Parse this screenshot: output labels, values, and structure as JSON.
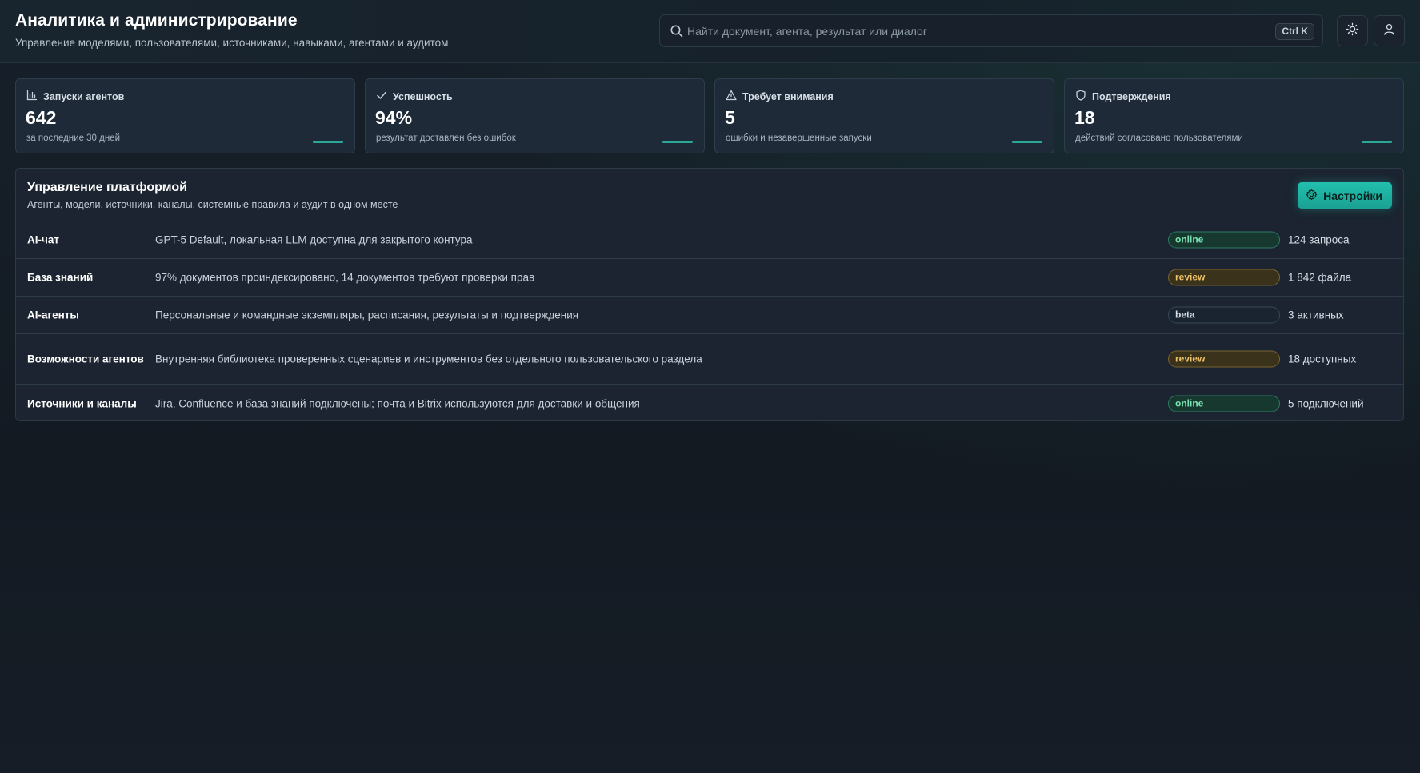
{
  "header": {
    "title": "Аналитика и администрирование",
    "subtitle": "Управление моделями, пользователями, источниками, навыками, агентами и аудитом",
    "search_placeholder": "Найти документ, агента, результат или диалог",
    "search_shortcut": "Ctrl K",
    "theme_icon": "sun-icon",
    "profile_icon": "user-icon"
  },
  "stats": [
    {
      "label": "Запуски агентов",
      "value": "642",
      "caption": "за последние 30 дней",
      "icon": "bar-chart-icon"
    },
    {
      "label": "Успешность",
      "value": "94%",
      "caption": "результат доставлен без ошибок",
      "icon": "check-icon"
    },
    {
      "label": "Требует внимания",
      "value": "5",
      "caption": "ошибки и незавершенные запуски",
      "icon": "warning-icon"
    },
    {
      "label": "Подтверждения",
      "value": "18",
      "caption": "действий согласовано пользователями",
      "icon": "shield-icon"
    }
  ],
  "panel": {
    "title": "Управление платформой",
    "subtitle": "Агенты, модели, источники, каналы, системные правила и аудит в одном месте",
    "settings_label": "Настройки",
    "rows": [
      {
        "name": "AI-чат",
        "desc": "GPT-5 Default, локальная LLM доступна для закрытого контура",
        "status": "online",
        "count": "124 запроса"
      },
      {
        "name": "База знаний",
        "desc": "97% документов проиндексировано, 14 документов требуют проверки прав",
        "status": "review",
        "count": "1 842 файла"
      },
      {
        "name": "AI-агенты",
        "desc": "Персональные и командные экземпляры, расписания, результаты и подтверждения",
        "status": "beta",
        "count": "3 активных"
      },
      {
        "name": "Возможности агентов",
        "desc": "Внутренняя библиотека проверенных сценариев и инструментов без отдельного пользовательского раздела",
        "status": "review",
        "count": "18 доступных"
      },
      {
        "name": "Источники и каналы",
        "desc": "Jira, Confluence и база знаний подключены; почта и Bitrix используются для доставки и общения",
        "status": "online",
        "count": "5 подключений"
      }
    ]
  },
  "colors": {
    "accent": "#22bfae",
    "online": "#7be3b3",
    "review": "#f0c36a",
    "beta": "#d7dee6"
  }
}
